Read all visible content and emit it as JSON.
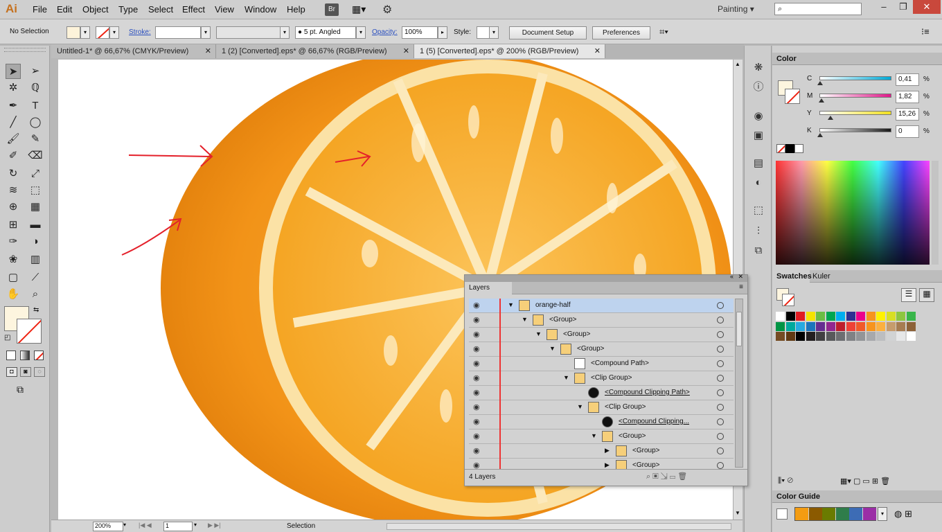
{
  "app": {
    "logo": "Ai",
    "menu": [
      "File",
      "Edit",
      "Object",
      "Type",
      "Select",
      "Effect",
      "View",
      "Window",
      "Help"
    ],
    "bridge": "Br",
    "workspace": "Painting",
    "window_controls": [
      "–",
      "❐",
      "✕"
    ]
  },
  "control_bar": {
    "selection": "No Selection",
    "stroke_label": "Stroke:",
    "brush": "5 pt. Angled",
    "opacity_label": "Opacity:",
    "opacity_value": "100%",
    "style_label": "Style:",
    "document_setup": "Document Setup",
    "preferences": "Preferences"
  },
  "tabs": [
    {
      "label": "Untitled-1* @ 66,67% (CMYK/Preview)",
      "active": false
    },
    {
      "label": "1 (2) [Converted].eps* @ 66,67% (RGB/Preview)",
      "active": false
    },
    {
      "label": "1 (5) [Converted].eps* @ 200% (RGB/Preview)",
      "active": true
    }
  ],
  "color_panel": {
    "title": "Color",
    "channels": [
      {
        "name": "C",
        "value": "0,41",
        "from": "#ffffff",
        "to": "#00a9d6",
        "level": 0.0041
      },
      {
        "name": "M",
        "value": "1,82",
        "from": "#ffffff",
        "to": "#e0188a",
        "level": 0.0182
      },
      {
        "name": "Y",
        "value": "15,26",
        "from": "#ffffff",
        "to": "#f1e020",
        "level": 0.1526
      },
      {
        "name": "K",
        "value": "0",
        "from": "#ffffff",
        "to": "#1a1a1a",
        "level": 0
      }
    ],
    "percent": "%",
    "fill_color": "#fdf5df"
  },
  "swatches_panel": {
    "tabs": [
      "Swatches",
      "Kuler"
    ],
    "colors": [
      "#ffffff",
      "#000000",
      "#e11b22",
      "#f5e400",
      "#6bbd45",
      "#00a651",
      "#00aeef",
      "#2e3192",
      "#ec008c",
      "#f7941d",
      "#fff200",
      "#d7df23",
      "#8dc63f",
      "#39b54a",
      "#009444",
      "#00a99d",
      "#27aae1",
      "#1c75bc",
      "#662d91",
      "#92278f",
      "#be1e2d",
      "#ef4136",
      "#f15a29",
      "#f7941d",
      "#fbb040",
      "#c69c6d",
      "#a67c52",
      "#8c6239",
      "#754c24",
      "#603913",
      "#000000",
      "#231f20",
      "#414042",
      "#58595b",
      "#6d6e71",
      "#808285",
      "#939598",
      "#a7a9ac",
      "#bcbec0",
      "#d1d3d4",
      "#e6e7e8",
      "#ffffff"
    ]
  },
  "color_guide": {
    "title": "Color Guide",
    "colors": [
      "#f39c12",
      "#8b5a00",
      "#6a7b00",
      "#2f7d4a",
      "#3d6cb5",
      "#9b2ea6"
    ]
  },
  "layers_panel": {
    "title": "Layers",
    "count": "4 Layers",
    "rows": [
      {
        "name": "orange-half",
        "depth": 0,
        "arrow": "▼",
        "thumb": "orange",
        "selected": true
      },
      {
        "name": "<Group>",
        "depth": 1,
        "arrow": "▼",
        "thumb": "orange",
        "selected": false
      },
      {
        "name": "<Group>",
        "depth": 2,
        "arrow": "▼",
        "thumb": "orange",
        "selected": false
      },
      {
        "name": "<Group>",
        "depth": 3,
        "arrow": "▼",
        "thumb": "orange",
        "selected": false
      },
      {
        "name": "<Compound Path>",
        "depth": 4,
        "arrow": "",
        "thumb": "white",
        "selected": false
      },
      {
        "name": "<Clip Group>",
        "depth": 4,
        "arrow": "▼",
        "thumb": "orange",
        "selected": false
      },
      {
        "name": "<Compound Clipping Path>",
        "depth": 5,
        "arrow": "",
        "thumb": "black",
        "selected": false,
        "underline": true
      },
      {
        "name": "<Clip Group>",
        "depth": 5,
        "arrow": "▼",
        "thumb": "orange",
        "selected": false
      },
      {
        "name": "<Compound Clipping...",
        "depth": 6,
        "arrow": "",
        "thumb": "black",
        "selected": false,
        "underline": true
      },
      {
        "name": "<Group>",
        "depth": 6,
        "arrow": "▼",
        "thumb": "orange",
        "selected": false
      },
      {
        "name": "<Group>",
        "depth": 7,
        "arrow": "▶",
        "thumb": "orange",
        "selected": false
      },
      {
        "name": "<Group>",
        "depth": 7,
        "arrow": "▶",
        "thumb": "orange",
        "selected": false
      }
    ]
  },
  "status_bar": {
    "zoom": "200%",
    "artboard": "1",
    "tool": "Selection"
  }
}
